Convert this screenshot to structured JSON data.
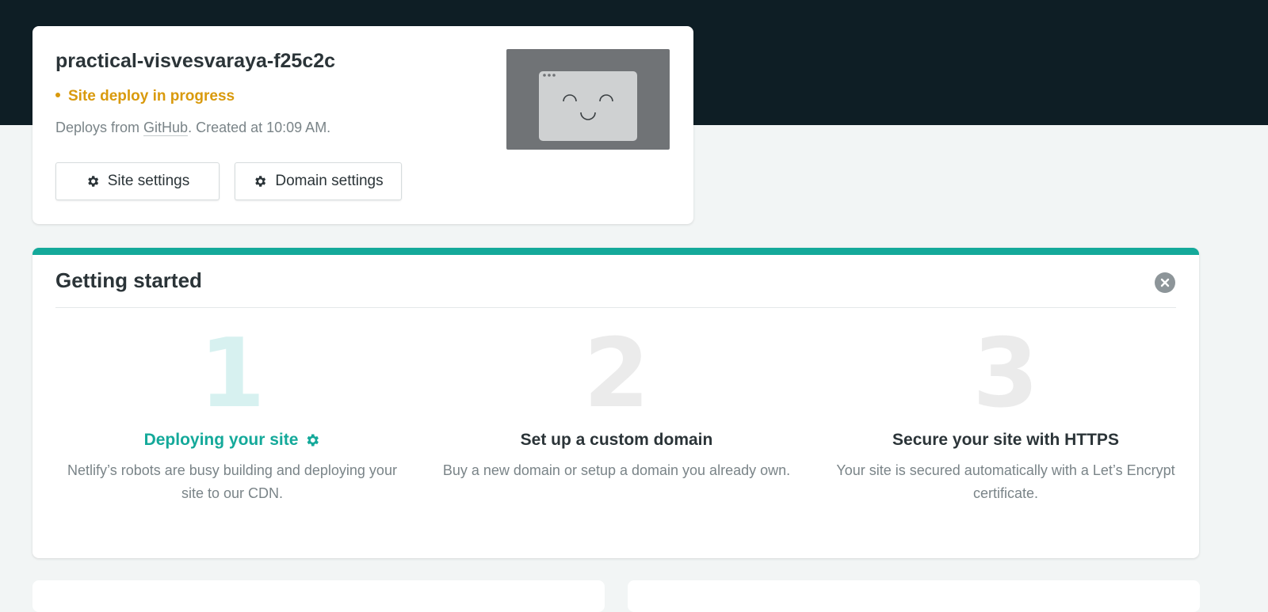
{
  "site": {
    "name": "practical-visvesvaraya-f25c2c",
    "status": "Site deploy in progress",
    "status_color": "#d99a0d",
    "meta_prefix": "Deploys from ",
    "meta_link": "GitHub",
    "meta_suffix": ". Created at 10:09 AM.",
    "buttons": {
      "site_settings": "Site settings",
      "domain_settings": "Domain settings"
    },
    "preview_icon": "smiling-browser-window-icon"
  },
  "getting_started": {
    "title": "Getting started",
    "accent_color": "#14a99a",
    "steps": [
      {
        "number": "1",
        "title": "Deploying your site",
        "icon": "spinning-gear-icon",
        "description": "Netlify’s robots are busy building and deploying your site to our CDN."
      },
      {
        "number": "2",
        "title": "Set up a custom domain",
        "description": "Buy a new domain or setup a domain you already own."
      },
      {
        "number": "3",
        "title": "Secure your site with HTTPS",
        "description": "Your site is secured automatically with a Let’s Encrypt certificate."
      }
    ]
  }
}
